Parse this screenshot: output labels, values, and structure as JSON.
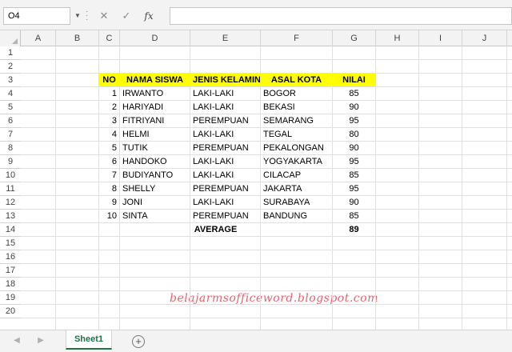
{
  "formula_bar": {
    "name_box": "O4",
    "cancel_icon": "✕",
    "enter_icon": "✓",
    "fx_label": "fx",
    "formula": ""
  },
  "columns": [
    "A",
    "B",
    "C",
    "D",
    "E",
    "F",
    "G",
    "H",
    "I",
    "J"
  ],
  "rows": [
    "1",
    "2",
    "3",
    "4",
    "5",
    "6",
    "7",
    "8",
    "9",
    "10",
    "11",
    "12",
    "13",
    "14",
    "15",
    "16",
    "17",
    "18",
    "19",
    "20"
  ],
  "table": {
    "headers": [
      "NO",
      "NAMA SISWA",
      "JENIS KELAMIN",
      "ASAL KOTA",
      "NILAI"
    ],
    "rows": [
      [
        "1",
        "IRWANTO",
        "LAKI-LAKI",
        "BOGOR",
        "85"
      ],
      [
        "2",
        "HARIYADI",
        "LAKI-LAKI",
        "BEKASI",
        "90"
      ],
      [
        "3",
        "FITRIYANI",
        "PEREMPUAN",
        "SEMARANG",
        "95"
      ],
      [
        "4",
        "HELMI",
        "LAKI-LAKI",
        "TEGAL",
        "80"
      ],
      [
        "5",
        "TUTIK",
        "PEREMPUAN",
        "PEKALONGAN",
        "90"
      ],
      [
        "6",
        "HANDOKO",
        "LAKI-LAKI",
        "YOGYAKARTA",
        "95"
      ],
      [
        "7",
        "BUDIYANTO",
        "LAKI-LAKI",
        "CILACAP",
        "85"
      ],
      [
        "8",
        "SHELLY",
        "PEREMPUAN",
        "JAKARTA",
        "95"
      ],
      [
        "9",
        "JONI",
        "LAKI-LAKI",
        "SURABAYA",
        "90"
      ],
      [
        "10",
        "SINTA",
        "PEREMPUAN",
        "BANDUNG",
        "85"
      ]
    ],
    "average_label": "AVERAGE",
    "average_value": "89",
    "header_color": "#ffff00"
  },
  "watermark": "belajarmsofficeword.blogspot.com",
  "sheet_tabs": {
    "active": "Sheet1",
    "add_icon": "+",
    "accent": "#217346"
  }
}
